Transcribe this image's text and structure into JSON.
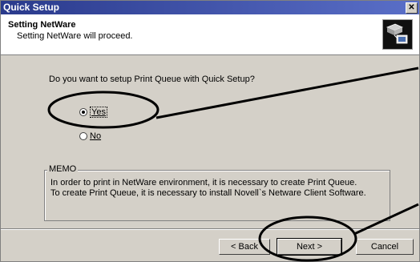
{
  "window": {
    "title": "Quick Setup",
    "close_glyph": "✕"
  },
  "header": {
    "title": "Setting NetWare",
    "subtitle": "Setting NetWare will proceed.",
    "icon": "printer-network-icon"
  },
  "question": "Do you want to setup Print Queue with Quick Setup?",
  "options": {
    "yes": "Yes",
    "no": "No",
    "selected": "yes"
  },
  "memo": {
    "label": "MEMO",
    "line1": "In order to print in NetWare environment, it is necessary to create Print Queue.",
    "line2": "To create Print Queue, it is necessary to install Novell`s Netware Client Software."
  },
  "buttons": {
    "back": "< Back",
    "next": "Next >",
    "cancel": "Cancel"
  },
  "colors": {
    "titlebar": "#2a3a8c",
    "dialog": "#d4d0c8"
  }
}
